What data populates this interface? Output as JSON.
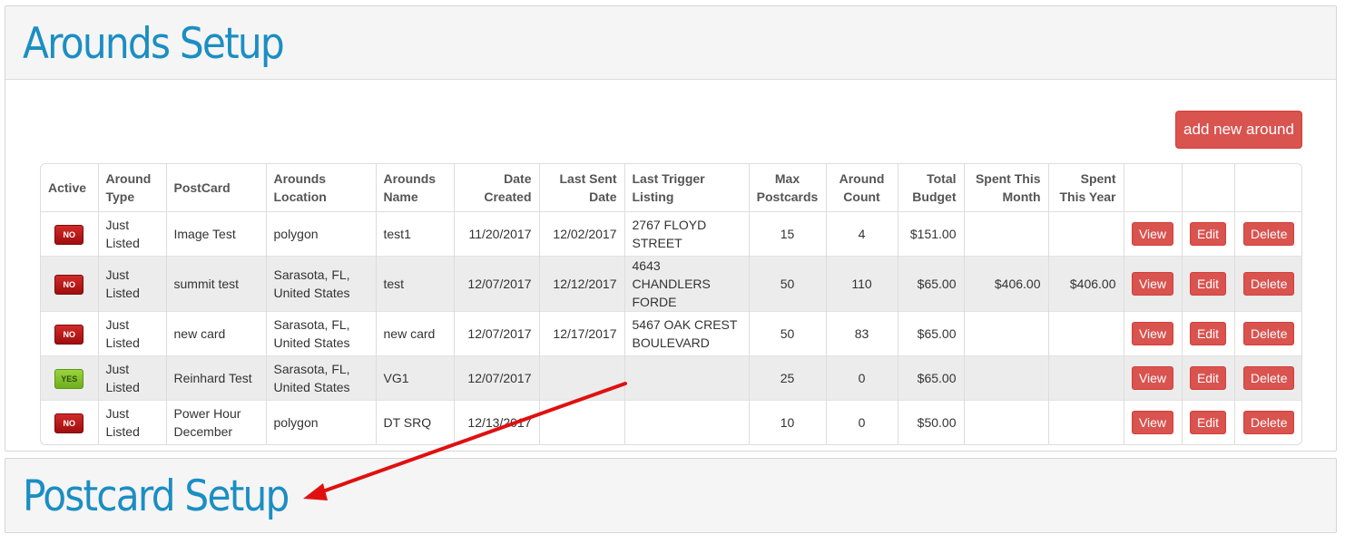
{
  "arounds_panel": {
    "title": "Arounds Setup",
    "add_button": "add new around"
  },
  "postcard_panel": {
    "title": "Postcard Setup"
  },
  "colors": {
    "title_blue": "#1b8ec3",
    "button_red": "#d9534f",
    "badge_no": "#b71414",
    "badge_yes": "#86c330",
    "arrow_red": "#e01010"
  },
  "table": {
    "headers": [
      "Active",
      "Around Type",
      "PostCard",
      "Arounds Location",
      "Arounds Name",
      "Date Created",
      "Last Sent Date",
      "Last Trigger Listing",
      "Max Postcards",
      "Around Count",
      "Total Budget",
      "Spent This Month",
      "Spent This Year",
      "",
      "",
      ""
    ],
    "rows": [
      {
        "active": "NO",
        "type": "Just Listed",
        "postcard": "Image Test",
        "location": "polygon",
        "name": "test1",
        "created": "11/20/2017",
        "last_sent": "12/02/2017",
        "trigger": "2767 FLOYD STREET",
        "max": "15",
        "count": "4",
        "budget": "$151.00",
        "spent_month": "",
        "spent_year": "",
        "view": "View",
        "edit": "Edit",
        "delete": "Delete"
      },
      {
        "active": "NO",
        "type": "Just Listed",
        "postcard": "summit test",
        "location": "Sarasota, FL, United States",
        "name": "test",
        "created": "12/07/2017",
        "last_sent": "12/12/2017",
        "trigger": "4643 CHANDLERS FORDE",
        "max": "50",
        "count": "110",
        "budget": "$65.00",
        "spent_month": "$406.00",
        "spent_year": "$406.00",
        "view": "View",
        "edit": "Edit",
        "delete": "Delete"
      },
      {
        "active": "NO",
        "type": "Just Listed",
        "postcard": "new card",
        "location": "Sarasota, FL, United States",
        "name": "new card",
        "created": "12/07/2017",
        "last_sent": "12/17/2017",
        "trigger": "5467 OAK CREST BOULEVARD",
        "max": "50",
        "count": "83",
        "budget": "$65.00",
        "spent_month": "",
        "spent_year": "",
        "view": "View",
        "edit": "Edit",
        "delete": "Delete"
      },
      {
        "active": "YES",
        "type": "Just Listed",
        "postcard": "Reinhard Test",
        "location": "Sarasota, FL, United States",
        "name": "VG1",
        "created": "12/07/2017",
        "last_sent": "",
        "trigger": "",
        "max": "25",
        "count": "0",
        "budget": "$65.00",
        "spent_month": "",
        "spent_year": "",
        "view": "View",
        "edit": "Edit",
        "delete": "Delete"
      },
      {
        "active": "NO",
        "type": "Just Listed",
        "postcard": "Power Hour December",
        "location": "polygon",
        "name": "DT SRQ",
        "created": "12/13/2017",
        "last_sent": "",
        "trigger": "",
        "max": "10",
        "count": "0",
        "budget": "$50.00",
        "spent_month": "",
        "spent_year": "",
        "view": "View",
        "edit": "Edit",
        "delete": "Delete"
      }
    ]
  }
}
